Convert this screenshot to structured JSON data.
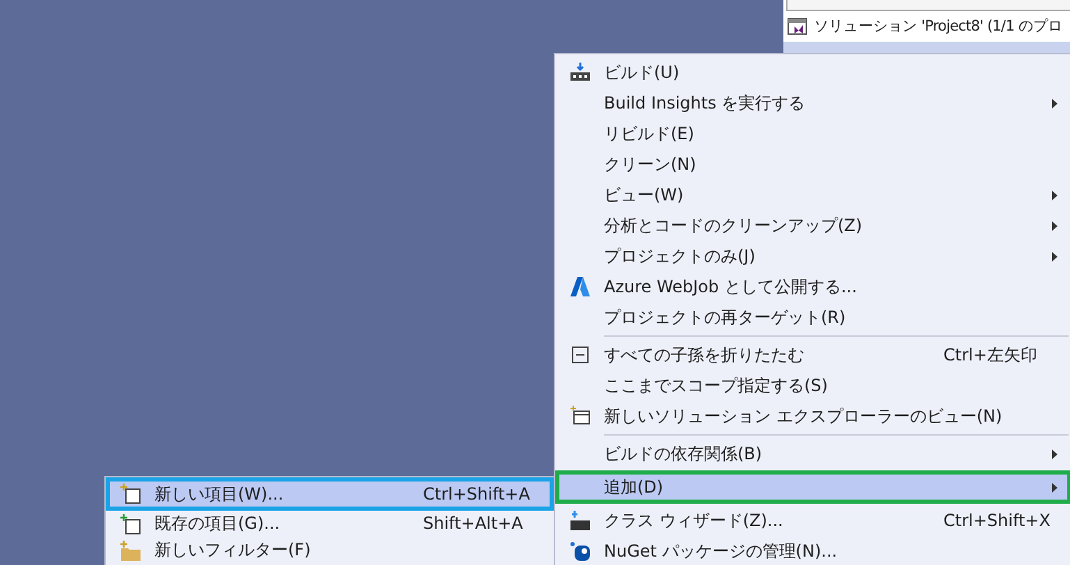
{
  "solution_explorer": {
    "solution_row": "ソリューション 'Project8' (1/1 のプロ"
  },
  "context_menu": {
    "items": [
      {
        "kind": "item",
        "label": "ビルド(U)",
        "submenu": false,
        "selected": false
      },
      {
        "kind": "item",
        "label": "Build Insights を実行する",
        "submenu": true,
        "selected": false
      },
      {
        "kind": "item",
        "label": "リビルド(E)",
        "submenu": false,
        "selected": false
      },
      {
        "kind": "item",
        "label": "クリーン(N)",
        "submenu": false,
        "selected": false
      },
      {
        "kind": "item",
        "label": "ビュー(W)",
        "submenu": true,
        "selected": false
      },
      {
        "kind": "item",
        "label": "分析とコードのクリーンアップ(Z)",
        "submenu": true,
        "selected": false
      },
      {
        "kind": "item",
        "label": "プロジェクトのみ(J)",
        "submenu": true,
        "selected": false
      },
      {
        "kind": "item",
        "label": "Azure WebJob として公開する...",
        "submenu": false,
        "selected": false
      },
      {
        "kind": "item",
        "label": "プロジェクトの再ターゲット(R)",
        "submenu": false,
        "selected": false
      },
      {
        "kind": "separator"
      },
      {
        "kind": "item",
        "label": "すべての子孫を折りたたむ",
        "shortcut": "Ctrl+左矢印",
        "submenu": false,
        "selected": false
      },
      {
        "kind": "item",
        "label": "ここまでスコープ指定する(S)",
        "submenu": false,
        "selected": false
      },
      {
        "kind": "item",
        "label": "新しいソリューション エクスプローラーのビュー(N)",
        "submenu": false,
        "selected": false
      },
      {
        "kind": "separator"
      },
      {
        "kind": "item",
        "label": "ビルドの依存関係(B)",
        "submenu": true,
        "selected": false
      },
      {
        "kind": "item",
        "label": "追加(D)",
        "submenu": true,
        "selected": true
      },
      {
        "kind": "item",
        "label": "クラス ウィザード(Z)...",
        "shortcut": "Ctrl+Shift+X",
        "submenu": false,
        "selected": false
      },
      {
        "kind": "item",
        "label": "NuGet パッケージの管理(N)...",
        "submenu": false,
        "selected": false
      }
    ]
  },
  "add_submenu": {
    "items": [
      {
        "label": "新しい項目(W)...",
        "shortcut": "Ctrl+Shift+A",
        "selected": true
      },
      {
        "label": "既存の項目(G)...",
        "shortcut": "Shift+Alt+A",
        "selected": false
      },
      {
        "label": "新しいフィルター(F)",
        "selected": false
      }
    ]
  }
}
